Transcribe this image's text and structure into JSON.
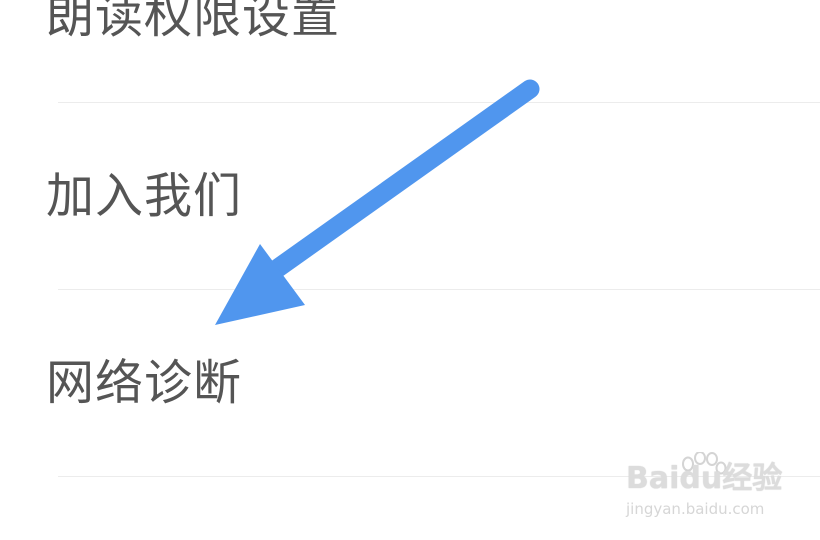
{
  "settings_list": {
    "items": [
      {
        "label": "朗读权限设置"
      },
      {
        "label": "加入我们"
      },
      {
        "label": "网络诊断"
      }
    ]
  },
  "annotation": {
    "arrow_color": "#5096ee",
    "icon": "arrow-pointing-icon"
  },
  "watermark": {
    "logo": "Baidu经验",
    "url": "jingyan.baidu.com"
  },
  "colors": {
    "text": "#555555",
    "divider": "#ececec",
    "background": "#ffffff"
  }
}
